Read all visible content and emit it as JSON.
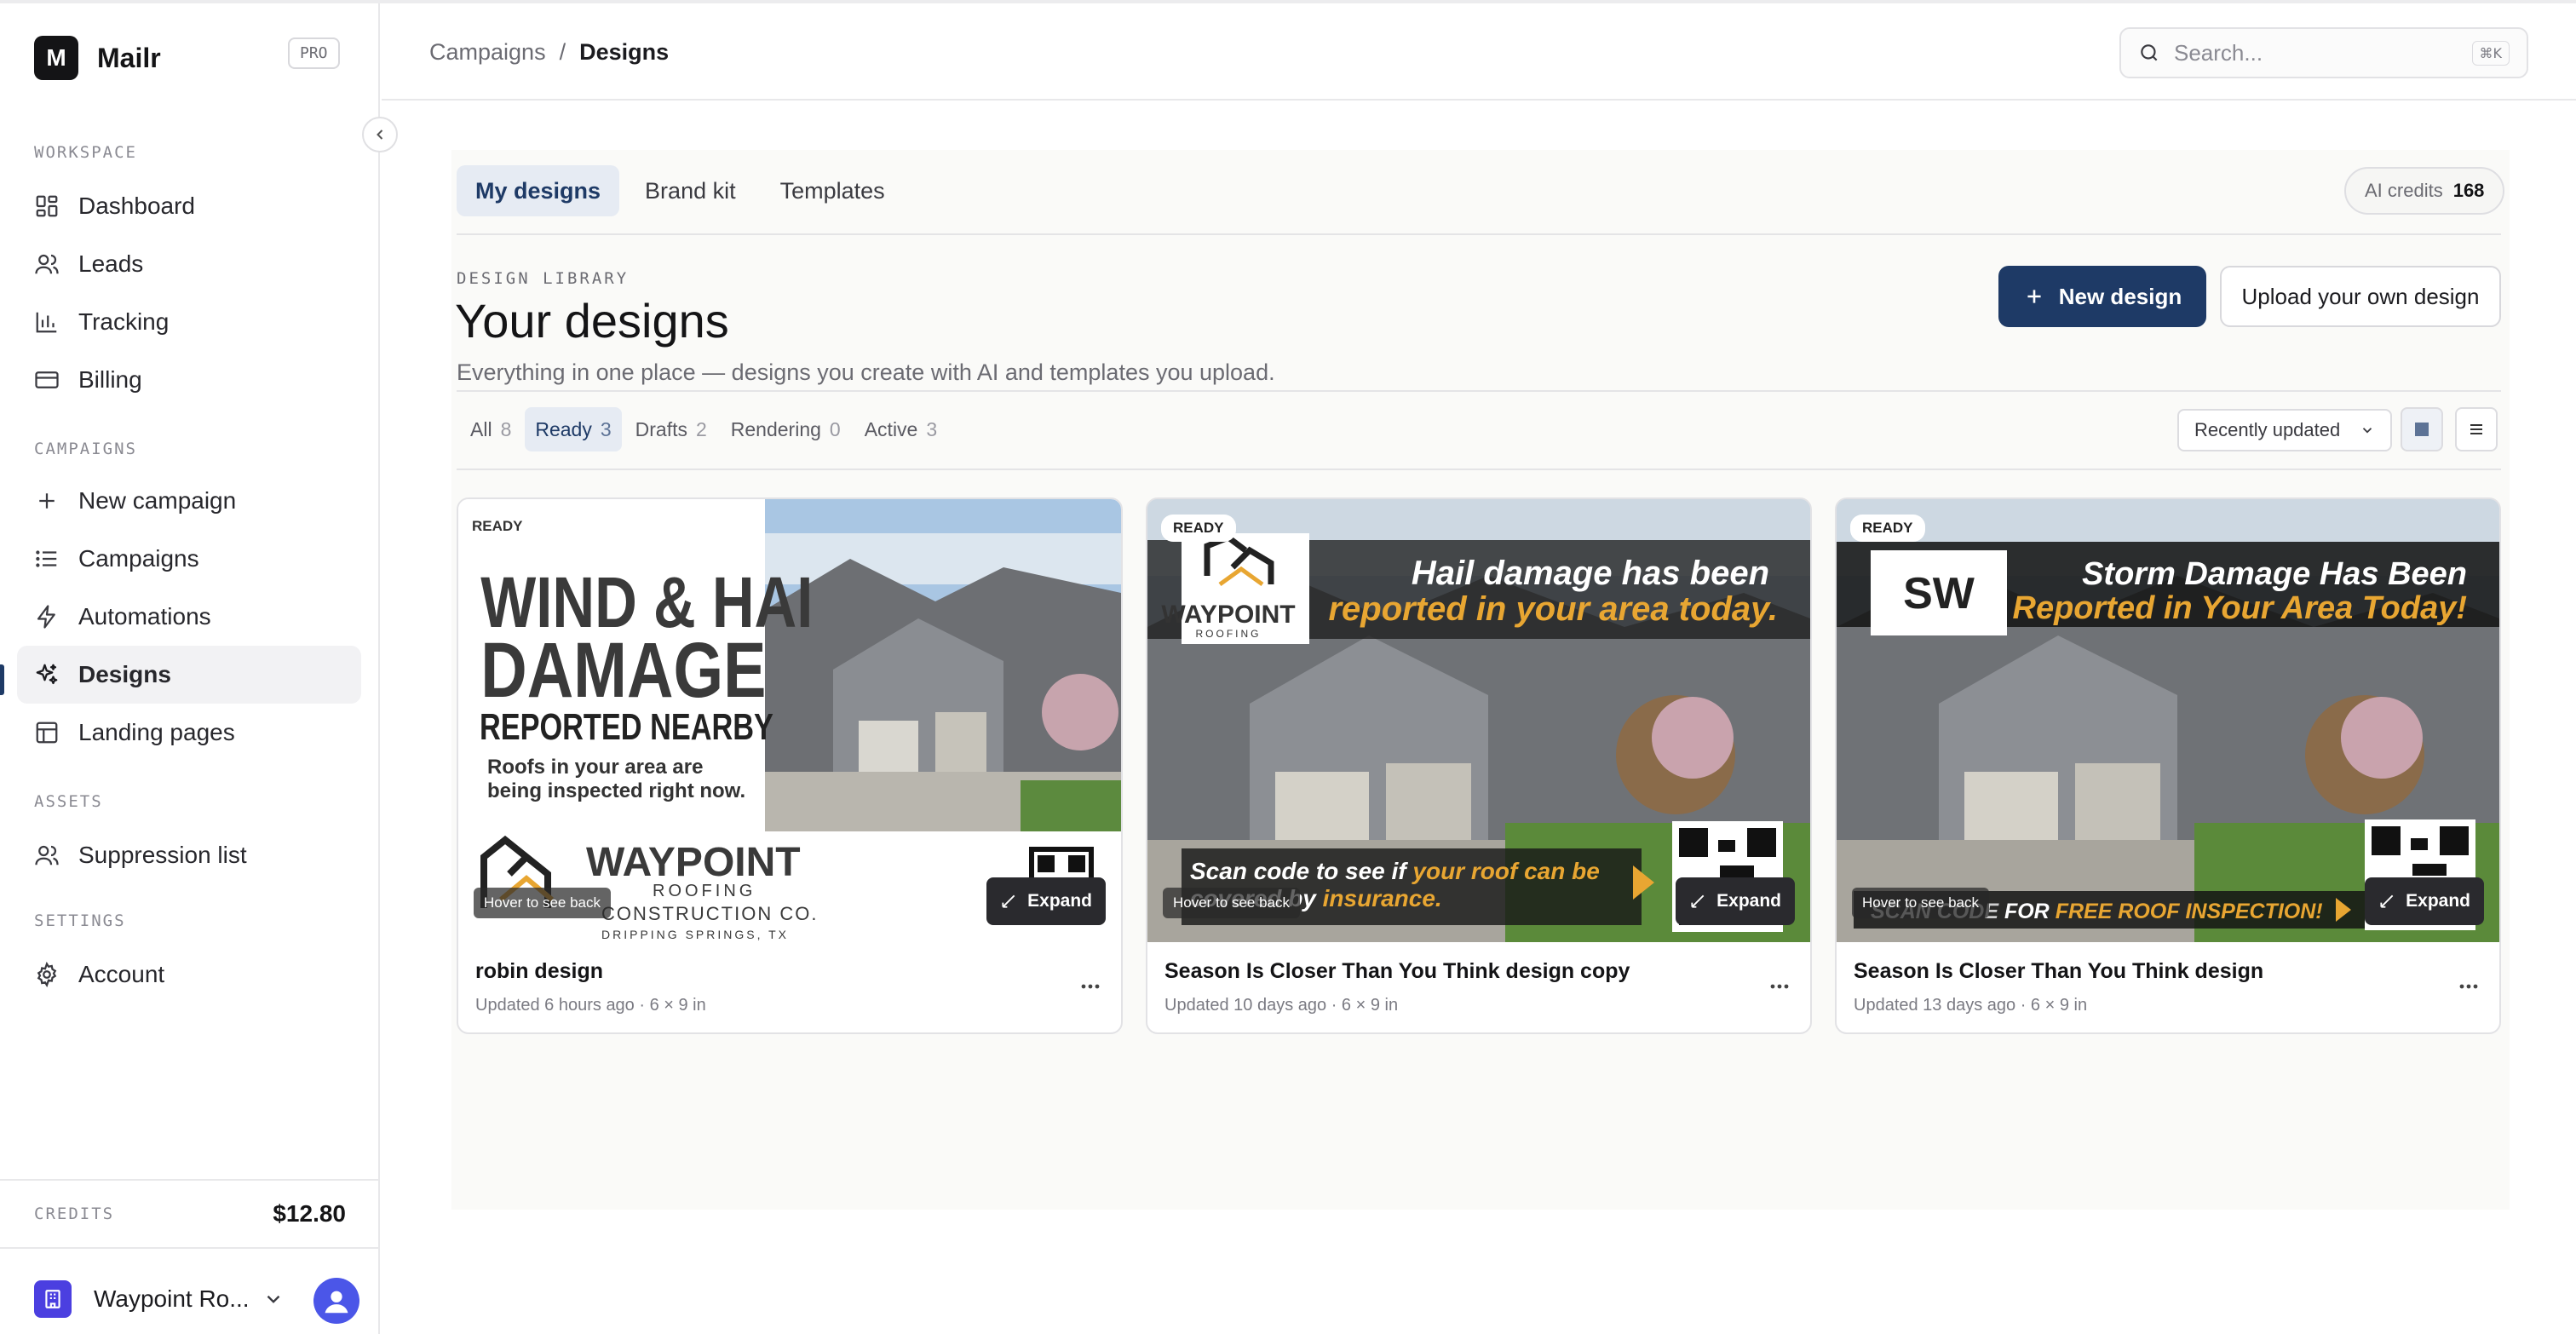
{
  "app": {
    "name": "Mailr",
    "logo_letter": "M",
    "plan_badge": "PRO"
  },
  "sidebar": {
    "sections": {
      "workspace": "WORKSPACE",
      "campaigns": "CAMPAIGNS",
      "assets": "ASSETS",
      "settings": "SETTINGS"
    },
    "items": {
      "dashboard": "Dashboard",
      "leads": "Leads",
      "tracking": "Tracking",
      "billing": "Billing",
      "new_campaign": "New campaign",
      "campaigns": "Campaigns",
      "automations": "Automations",
      "designs": "Designs",
      "landing_pages": "Landing pages",
      "suppression_list": "Suppression list",
      "account": "Account"
    },
    "credits_label": "CREDITS",
    "credits_value": "$12.80",
    "org_name": "Waypoint Ro..."
  },
  "header": {
    "breadcrumb_parent": "Campaigns",
    "breadcrumb_sep": "/",
    "breadcrumb_current": "Designs",
    "search_placeholder": "Search...",
    "search_shortcut": "⌘K"
  },
  "tabs": [
    "My designs",
    "Brand kit",
    "Templates"
  ],
  "ai_credits": {
    "label": "AI credits",
    "value": "168"
  },
  "library": {
    "eyebrow": "DESIGN LIBRARY",
    "title": "Your designs",
    "subtitle": "Everything in one place — designs you create with AI and templates you upload.",
    "new_button": "New design",
    "upload_button": "Upload your own design"
  },
  "filters": [
    {
      "label": "All",
      "count": "8"
    },
    {
      "label": "Ready",
      "count": "3"
    },
    {
      "label": "Drafts",
      "count": "2"
    },
    {
      "label": "Rendering",
      "count": "0"
    },
    {
      "label": "Active",
      "count": "3"
    }
  ],
  "sort": {
    "selected": "Recently updated"
  },
  "cards": [
    {
      "status": "READY",
      "title": "robin design",
      "meta": "Updated 6 hours ago · 6 × 9 in",
      "art": {
        "line1": "WIND & HAIL",
        "line2": "DAMAGE",
        "line3": "REPORTED NEARBY",
        "body1": "Roofs in your area are",
        "body2": "being inspected right now.",
        "brand": "WAYPOINT",
        "brand_sub1": "ROOFING",
        "brand_sub2": "CONSTRUCTION CO.",
        "brand_loc": "DRIPPING SPRINGS, TX"
      },
      "hover_hint": "Hover to see back",
      "expand": "Expand"
    },
    {
      "status": "READY",
      "title": "Season Is Closer Than You Think design copy",
      "meta": "Updated 10 days ago · 6 × 9 in",
      "art": {
        "brand": "WAYPOINT",
        "brand_sub1": "ROOFING",
        "head1": "Hail damage has been",
        "head2": "reported in your area today.",
        "cta1_a": "Scan code to see if ",
        "cta1_b": "your roof can be",
        "cta2_a": "covered by ",
        "cta2_b": "insurance."
      },
      "hover_hint": "Hover to see back",
      "expand": "Expand"
    },
    {
      "status": "READY",
      "title": "Season Is Closer Than You Think design",
      "meta": "Updated 13 days ago · 6 × 9 in",
      "art": {
        "brand": "SW",
        "head1": "Storm Damage Has Been",
        "head2": "Reported in Your Area Today!",
        "cta_a": "SCAN CODE ",
        "cta_b": "FOR ",
        "cta_c": "FREE ROOF INSPECTION!"
      },
      "hover_hint": "Hover to see back",
      "expand": "Expand"
    }
  ],
  "colors": {
    "accent": "#1e3a66",
    "headline_gold": "#e8a632",
    "org_icon": "#4b3fe0",
    "avatar": "#4b56e8"
  }
}
